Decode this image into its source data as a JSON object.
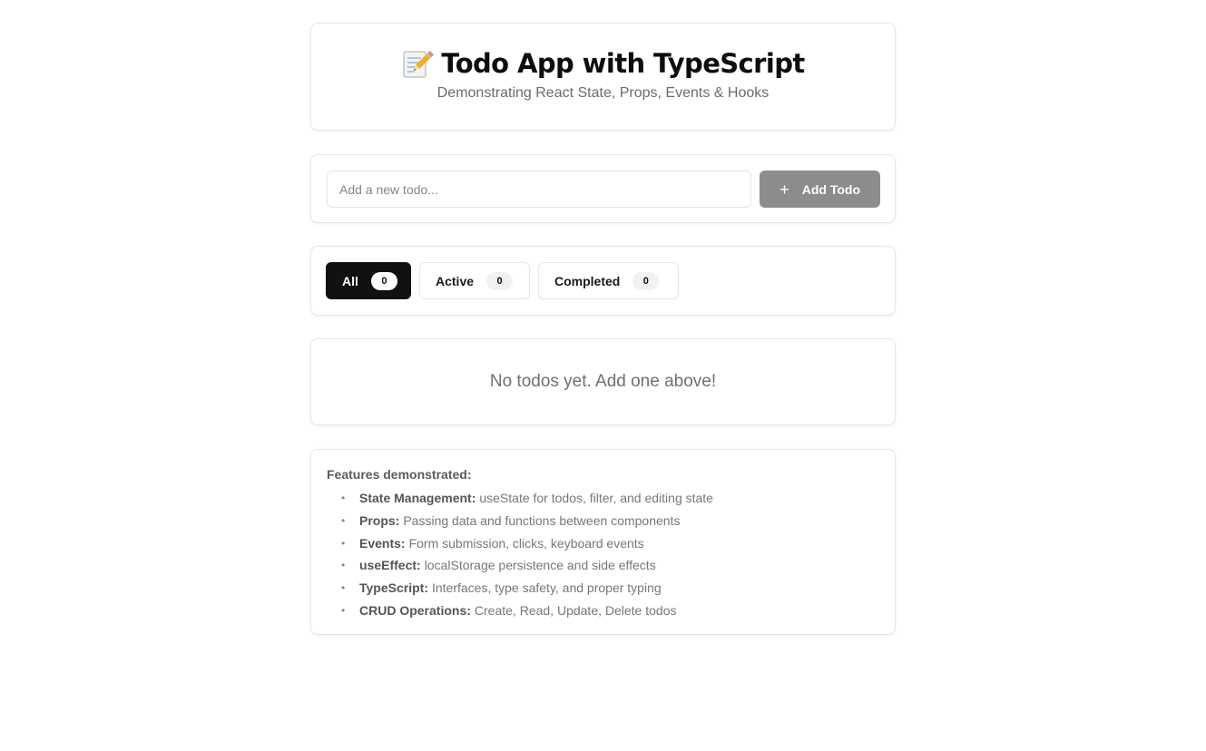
{
  "header": {
    "icon": "memo-pencil-icon",
    "title": "Todo App with TypeScript",
    "subtitle": "Demonstrating React State, Props, Events & Hooks"
  },
  "add_todo": {
    "placeholder": "Add a new todo...",
    "value": "",
    "button_icon": "plus-icon",
    "button_label": "Add Todo"
  },
  "filters": [
    {
      "label": "All",
      "count": "0",
      "selected": true
    },
    {
      "label": "Active",
      "count": "0",
      "selected": false
    },
    {
      "label": "Completed",
      "count": "0",
      "selected": false
    }
  ],
  "empty_state": {
    "message": "No todos yet. Add one above!"
  },
  "features": {
    "heading": "Features demonstrated:",
    "items": [
      {
        "name": "State Management:",
        "desc": "useState for todos, filter, and editing state"
      },
      {
        "name": "Props:",
        "desc": "Passing data and functions between components"
      },
      {
        "name": "Events:",
        "desc": "Form submission, clicks, keyboard events"
      },
      {
        "name": "useEffect:",
        "desc": "localStorage persistence and side effects"
      },
      {
        "name": "TypeScript:",
        "desc": "Interfaces, type safety, and proper typing"
      },
      {
        "name": "CRUD Operations:",
        "desc": "Create, Read, Update, Delete todos"
      }
    ]
  },
  "colors": {
    "primary_dark": "#111111",
    "button_disabled": "#8c8c8c",
    "border": "#e5e5e5",
    "muted_text": "#6b6b6b"
  }
}
